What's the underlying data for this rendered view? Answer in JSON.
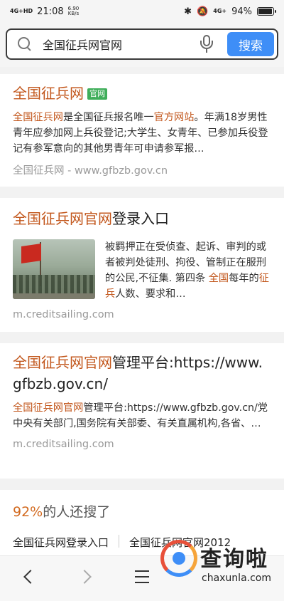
{
  "status_bar": {
    "signal_left": "4G+HD",
    "time": "21:08",
    "speed": "6.90\nKB/s",
    "signal_right": "4G+",
    "battery": "94%",
    "battery_level": 0.94
  },
  "search": {
    "query": "全国征兵网官网",
    "button_label": "搜索"
  },
  "results": [
    {
      "title_hl": "全国征兵网",
      "title_rest": "",
      "badge": "官网",
      "body_parts": [
        {
          "t": "全国征兵网",
          "hl": true
        },
        {
          "t": "是全国征兵报名唯一",
          "hl": false
        },
        {
          "t": "官方网站",
          "hl": true
        },
        {
          "t": "。年满18岁男性青年应参加网上兵役登记;大学生、女青年、已参加兵役登记有参军意向的其他男青年可申请参军报…",
          "hl": false
        }
      ],
      "url": "全国征兵网 - www.gfbzb.gov.cn"
    },
    {
      "title_hl": "全国征兵网官网",
      "title_rest": "登录入口",
      "body_parts": [
        {
          "t": "被羁押正在受侦查、起诉、审判的或者被判处徒刑、拘役、管制正在服刑的公民,不征集. 第四条 ",
          "hl": false
        },
        {
          "t": "全国",
          "hl": true
        },
        {
          "t": "每年的",
          "hl": false
        },
        {
          "t": "征兵",
          "hl": true
        },
        {
          "t": "人数、要求和…",
          "hl": false
        }
      ],
      "url": "m.creditsailing.com"
    },
    {
      "title_hl": "全国征兵网官网",
      "title_rest": "管理平台:https://www.gfbzb.gov.cn/",
      "body_parts": [
        {
          "t": "全国征兵网官网",
          "hl": true
        },
        {
          "t": "管理平台:https://www.gfbzb.gov.cn/党中央有关部门,国务院有关部委、有关直属机构,各省、…",
          "hl": false
        }
      ],
      "url": "m.creditsailing.com"
    }
  ],
  "related": {
    "pct": "92%",
    "title_rest": "的人还搜了",
    "items": [
      "全国征兵网登录入口",
      "全国征兵网官网2012"
    ]
  },
  "watermark": {
    "name": "查询啦",
    "url": "chaxunla.com"
  }
}
